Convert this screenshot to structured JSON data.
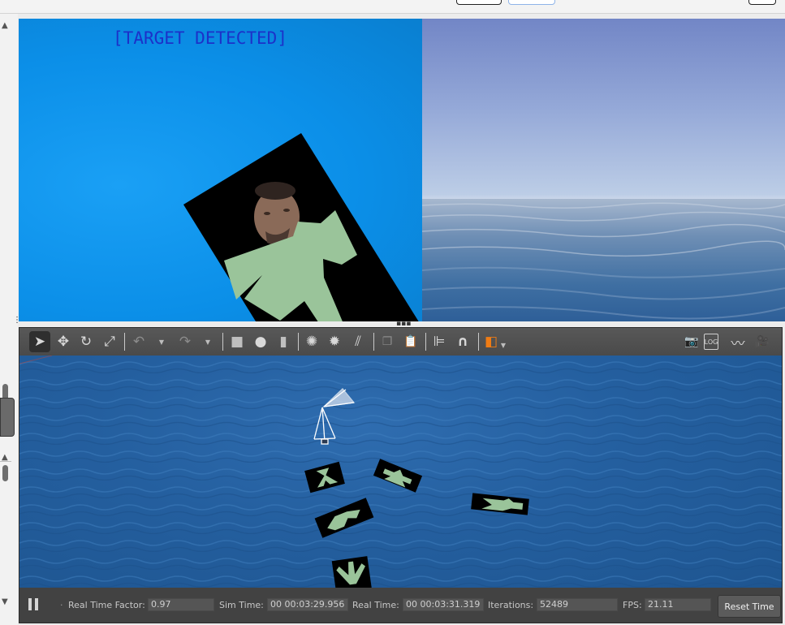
{
  "camera_view": {
    "overlay_text": "[TARGET DETECTED]"
  },
  "toolbar": {
    "tools": [
      {
        "name": "select-tool",
        "glyph": "➤"
      },
      {
        "name": "translate-tool",
        "glyph": "✥"
      },
      {
        "name": "rotate-tool",
        "glyph": "↻"
      },
      {
        "name": "scale-tool",
        "glyph": "⤢"
      },
      {
        "name": "undo-tool",
        "glyph": "↶"
      },
      {
        "name": "redo-tool",
        "glyph": "↷"
      },
      {
        "name": "box-tool",
        "glyph": "■"
      },
      {
        "name": "sphere-tool",
        "glyph": "●"
      },
      {
        "name": "cylinder-tool",
        "glyph": "▮"
      },
      {
        "name": "point-light-tool",
        "glyph": "✺"
      },
      {
        "name": "spot-light-tool",
        "glyph": "✹"
      },
      {
        "name": "directional-light-tool",
        "glyph": "⫽"
      },
      {
        "name": "copy-tool",
        "glyph": "❐"
      },
      {
        "name": "paste-tool",
        "glyph": "📋"
      },
      {
        "name": "align-tool",
        "glyph": "⊫"
      },
      {
        "name": "snap-tool",
        "glyph": "∩"
      },
      {
        "name": "view-angle-tool",
        "glyph": "◧"
      },
      {
        "name": "screenshot-tool",
        "glyph": "📷"
      },
      {
        "name": "log-tool",
        "glyph": "LOG"
      },
      {
        "name": "plot-tool",
        "glyph": "〰"
      },
      {
        "name": "record-video-tool",
        "glyph": "🎥"
      }
    ]
  },
  "statusbar": {
    "real_time_factor_label": "Real Time Factor:",
    "real_time_factor": "0.97",
    "sim_time_label": "Sim Time:",
    "sim_time": "00 00:03:29.956",
    "real_time_label": "Real Time:",
    "real_time": "00 00:03:31.319",
    "iterations_label": "Iterations:",
    "iterations": "52489",
    "fps_label": "FPS:",
    "fps": "21.11",
    "reset_time_label": "Reset Time"
  },
  "colors": {
    "camera_background": "#0b8fe8",
    "overlay_text": "#1c31c9",
    "target_panel": "#000000",
    "target_figure": "#9ac49a",
    "ocean": "#245f9f",
    "toolbar": "#4f4f4f",
    "statusbar": "#424242"
  }
}
